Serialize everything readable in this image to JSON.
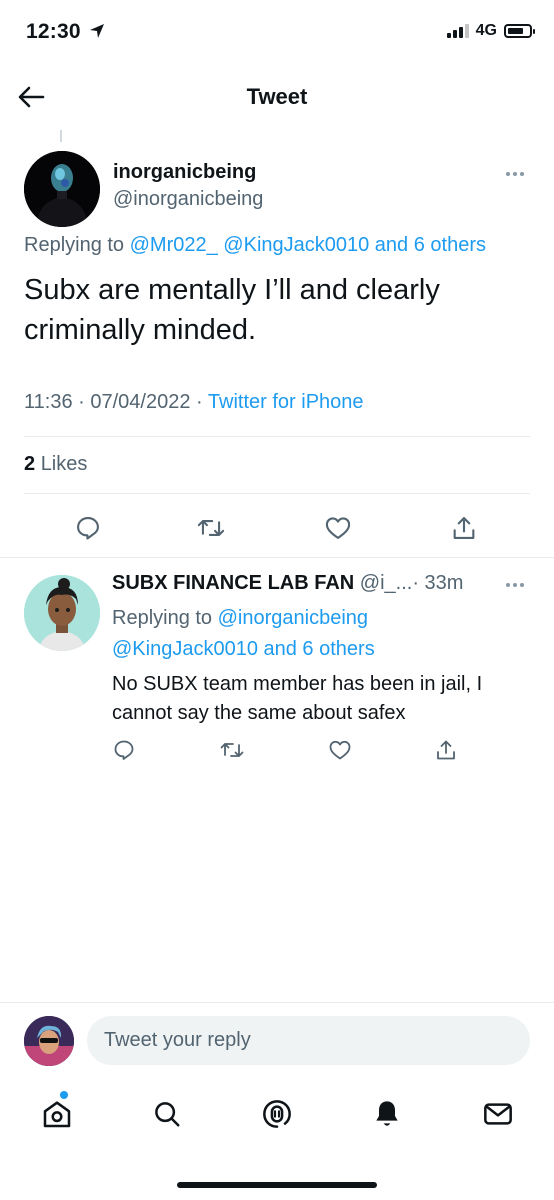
{
  "status_bar": {
    "time": "12:30",
    "network": "4G"
  },
  "header": {
    "title": "Tweet"
  },
  "main_tweet": {
    "display_name": "inorganicbeing",
    "handle": "@inorganicbeing",
    "replying_prefix": "Replying to",
    "replying_links": "@Mr022_ @KingJack0010 and 6 others",
    "text": "Subx are mentally I’ll and clearly criminally minded.",
    "time": "11:36",
    "date": "07/04/2022",
    "separator": "·",
    "source": "Twitter for iPhone",
    "likes_count": "2",
    "likes_label": "Likes"
  },
  "reply_tweet": {
    "display_name": "SUBX FINANCE LAB FAN",
    "handle": "@i_...",
    "age": "· 33m",
    "replying_prefix": "Replying to",
    "replying_links_1": "@inorganicbeing",
    "replying_links_2": "@KingJack0010 and 6 others",
    "text": "No SUBX team member has been in jail, I cannot say the same about safex"
  },
  "composer": {
    "placeholder": "Tweet your reply"
  },
  "icons": {
    "back": "back-arrow-icon",
    "more": "more-icon",
    "reply": "reply-icon",
    "retweet": "retweet-icon",
    "like": "like-icon",
    "share": "share-icon",
    "nav": [
      "home-icon",
      "search-icon",
      "spaces-icon",
      "notifications-icon",
      "messages-icon"
    ]
  },
  "colors": {
    "accent": "#1d9bf0",
    "text": "#0f1419",
    "secondary": "#536471",
    "divider": "#e6ecf0"
  }
}
